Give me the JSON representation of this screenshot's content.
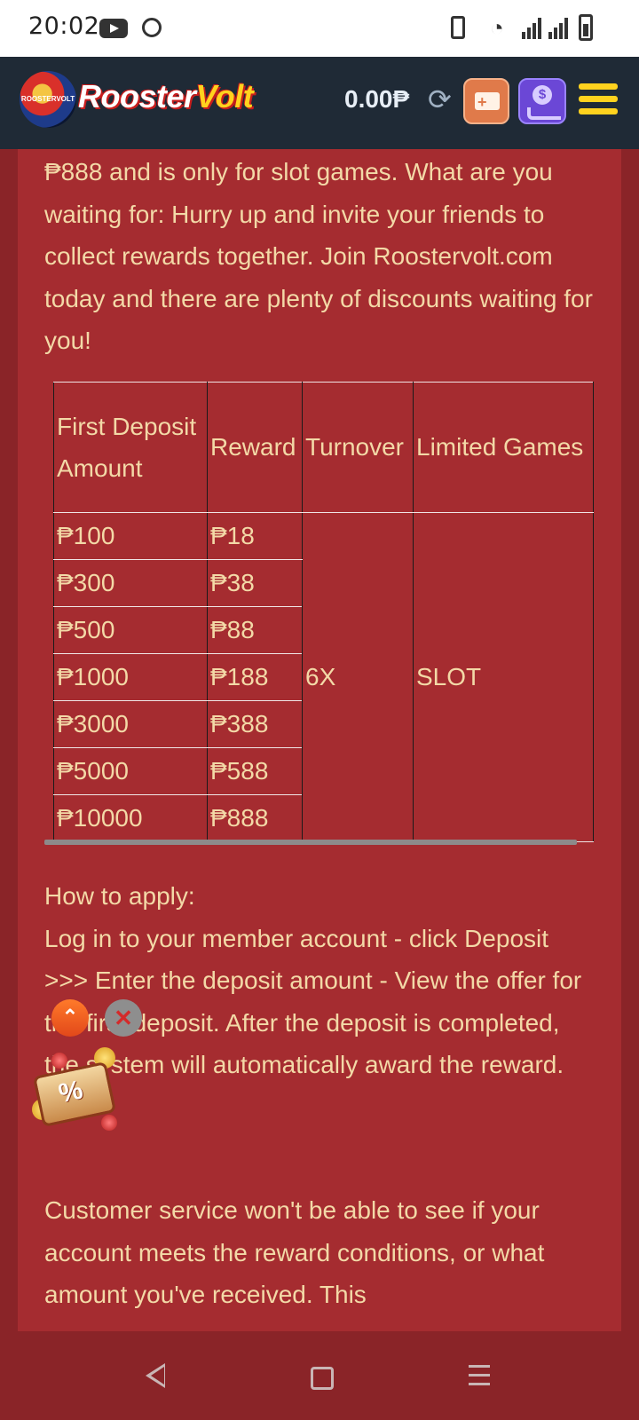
{
  "status_bar": {
    "time": "20:02",
    "icons": [
      "youtube-icon",
      "message-icon",
      "vibrate-icon",
      "wifi-icon",
      "signal-icon",
      "signal-icon",
      "battery-icon"
    ]
  },
  "header": {
    "logo_badge_text": "ROOSTERVOLT",
    "logo_text_a": "Rooster",
    "logo_text_b": "Volt",
    "balance": "0.00₱",
    "colors": {
      "background": "#1f2a36",
      "accent_yellow": "#ffd21e",
      "brand_red": "#c71d1d"
    }
  },
  "content": {
    "intro": "₱888 and is only for slot games. What are you waiting for: Hurry up and invite your friends to collect rewards together. Join Roostervolt.com today and there are plenty of discounts waiting for you!",
    "table": {
      "headers": [
        "First Deposit Amount",
        "Reward",
        "Turnover",
        "Limited Games"
      ],
      "rows": [
        {
          "deposit": "₱100",
          "reward": "₱18"
        },
        {
          "deposit": "₱300",
          "reward": "₱38"
        },
        {
          "deposit": "₱500",
          "reward": "₱88"
        },
        {
          "deposit": "₱1000",
          "reward": "₱188"
        },
        {
          "deposit": "₱3000",
          "reward": "₱388"
        },
        {
          "deposit": "₱5000",
          "reward": "₱588"
        },
        {
          "deposit": "₱10000",
          "reward": "₱888"
        }
      ],
      "turnover": "6X",
      "limited_games": "SLOT"
    },
    "how_to_apply_title": "How to apply:",
    "how_to_apply_body": "Log in to your member account - click Deposit >>> Enter the deposit amount - View the offer for the first deposit. After the deposit is completed, the system will automatically award the reward.",
    "customer_service": "Customer service won't be able to see if your account meets the reward conditions, or what amount you've received. This"
  },
  "floating": {
    "scroll_top_glyph": "⌃",
    "close_glyph": "✕",
    "promo_glyph": "%"
  },
  "colors": {
    "page_bg": "#8a2428",
    "content_bg": "#a52c30",
    "text": "#f3d9a7"
  }
}
